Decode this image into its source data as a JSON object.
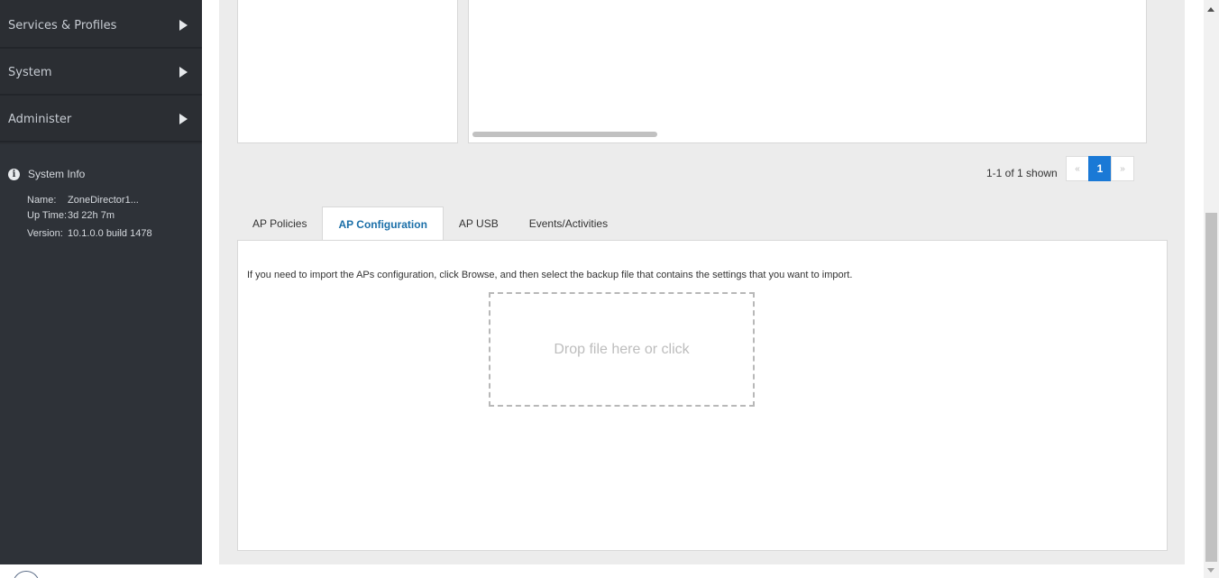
{
  "sidebar": {
    "nav": [
      {
        "label": "Services & Profiles"
      },
      {
        "label": "System"
      },
      {
        "label": "Administer"
      }
    ],
    "system_info": {
      "title": "System Info",
      "rows": [
        {
          "key": "Name:",
          "value": "ZoneDirector1..."
        },
        {
          "key": "Up Time:",
          "value": "3d 22h 7m"
        },
        {
          "key": "Version:",
          "value": "10.1.0.0 build 1478"
        }
      ]
    }
  },
  "pagination": {
    "summary": "1-1 of 1 shown",
    "prev": "«",
    "current": "1",
    "next": "»"
  },
  "tabs": [
    {
      "label": "AP Policies",
      "active": false
    },
    {
      "label": "AP Configuration",
      "active": true
    },
    {
      "label": "AP USB",
      "active": false
    },
    {
      "label": "Events/Activities",
      "active": false
    }
  ],
  "ap_configuration": {
    "instruction": "If you need to import the APs configuration, click Browse, and then select the backup file that contains the settings that you want to import.",
    "dropzone_label": "Drop file here or click"
  },
  "colors": {
    "sidebar_bg": "#2b2e33",
    "accent_blue": "#1a79d6",
    "active_tab_text": "#1b6fa8"
  }
}
